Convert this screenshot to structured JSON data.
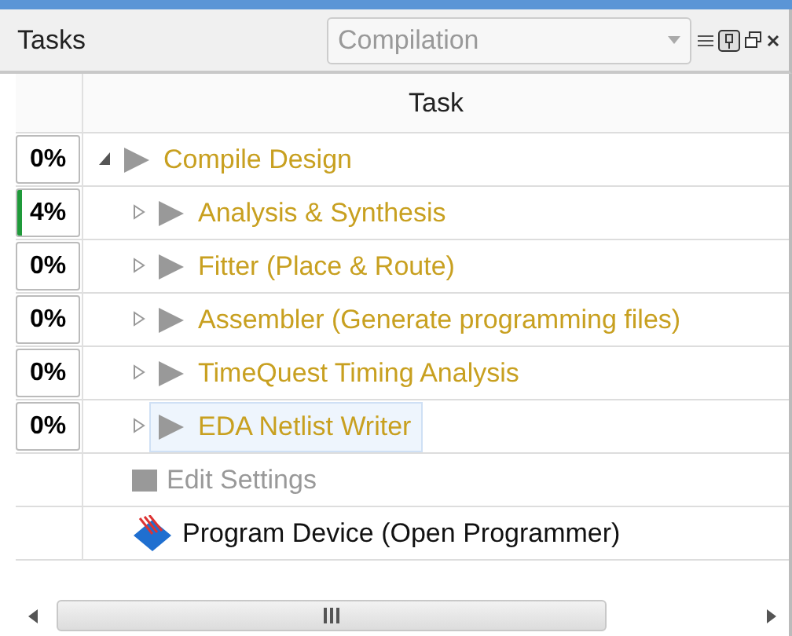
{
  "panel": {
    "title": "Tasks",
    "flow": "Compilation"
  },
  "table": {
    "columns": [
      "Task"
    ]
  },
  "tasks": [
    {
      "label": "Compile Design",
      "progress": "0%",
      "level": 0,
      "expanded": true,
      "selected": false,
      "children": [
        {
          "label": "Analysis & Synthesis",
          "progress": "4%",
          "level": 0.04,
          "expanded": false,
          "selected": false
        },
        {
          "label": "Fitter (Place & Route)",
          "progress": "0%",
          "level": 0,
          "expanded": false,
          "selected": false
        },
        {
          "label": "Assembler (Generate programming files)",
          "progress": "0%",
          "level": 0,
          "expanded": false,
          "selected": false
        },
        {
          "label": "TimeQuest Timing Analysis",
          "progress": "0%",
          "level": 0,
          "expanded": false,
          "selected": false
        },
        {
          "label": "EDA Netlist Writer",
          "progress": "0%",
          "level": 0,
          "expanded": false,
          "selected": true
        }
      ]
    }
  ],
  "actions": [
    {
      "kind": "settings",
      "label": "Edit Settings"
    },
    {
      "kind": "program",
      "label": "Program Device (Open Programmer)"
    }
  ]
}
